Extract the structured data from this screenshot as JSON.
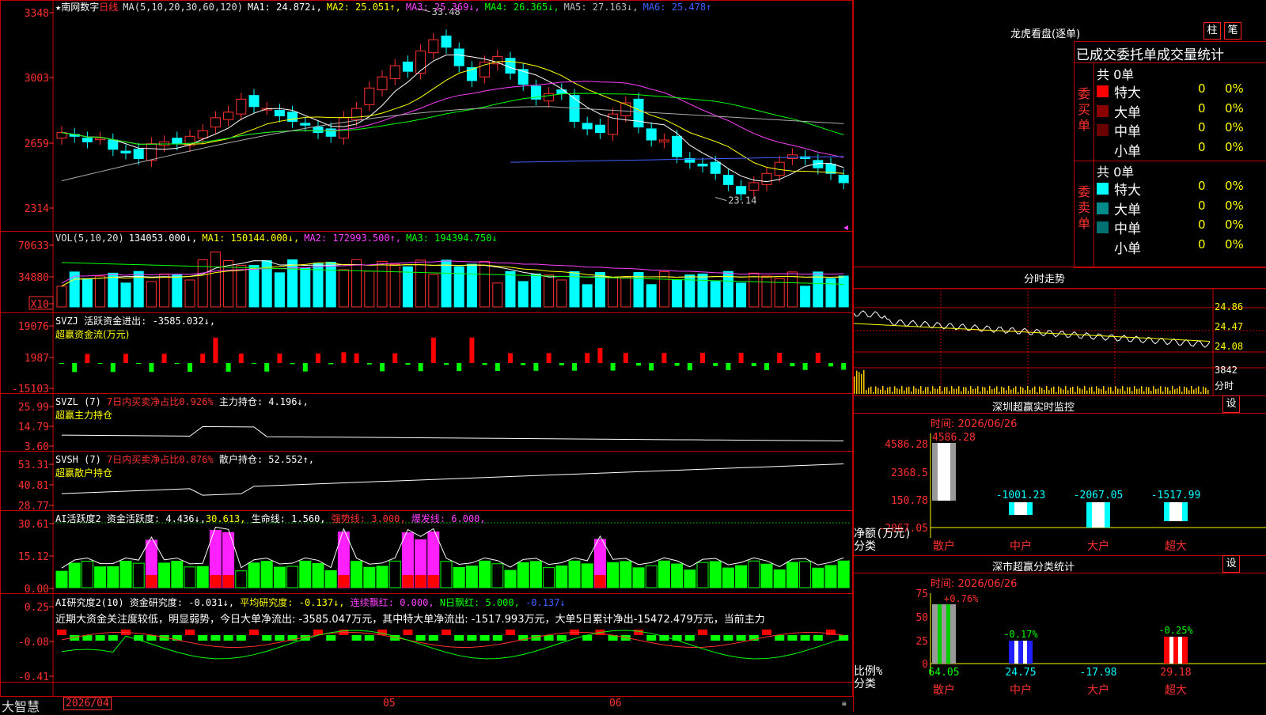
{
  "stock": {
    "star": "★",
    "name": "南网数字",
    "period": "日线"
  },
  "main_axis": [
    "3348",
    "3003",
    "2659",
    "2314"
  ],
  "ma_header": [
    {
      "text": "MA(5,10,20,30,60,120)",
      "color": "#dddddd"
    },
    {
      "text": "MA1: 24.872↓,",
      "color": "#ffffff"
    },
    {
      "text": "MA2: 25.051↑,",
      "color": "#ffff00"
    },
    {
      "text": "MA3: 25.369↓,",
      "color": "#ff40ff"
    },
    {
      "text": "MA4: 26.365↓,",
      "color": "#00ff00"
    },
    {
      "text": "MA5: 27.163↓,",
      "color": "#bbbbbb"
    },
    {
      "text": "MA6: 25.478↑",
      "color": "#4060ff"
    }
  ],
  "high_label": "33.48",
  "low_label": "23.14",
  "vol_axis": [
    "70633",
    "34880",
    "X10"
  ],
  "vol_header": [
    {
      "text": "VOL(5,10,20)",
      "color": "#dddddd"
    },
    {
      "text": "134053.000↓,",
      "color": "#ffffff"
    },
    {
      "text": "MA1: 150144.000↓,",
      "color": "#ffff00"
    },
    {
      "text": "MA2: 172993.500↑,",
      "color": "#ff40ff"
    },
    {
      "text": "MA3: 194394.750↓",
      "color": "#00ff00"
    }
  ],
  "svzj": {
    "axis": [
      "19076",
      "1987",
      "-15103"
    ],
    "line1": "SVZJ  活跃资金进出: -3585.032↓,",
    "line2": "超赢资金流(万元)"
  },
  "svzl": {
    "axis": [
      "25.99",
      "14.79",
      "3.60"
    ],
    "prefix": "SVZL (7)",
    "red": "7日内买卖净占比0.926%",
    "rest": "主力持仓: 4.196↓,",
    "line2": "超赢主力持仓"
  },
  "svsh": {
    "axis": [
      "53.31",
      "40.81",
      "28.77"
    ],
    "prefix": "SVSH (7)",
    "red": "7日内买卖净占比0.876%",
    "rest": "散户持仓: 52.552↑,",
    "line2": "超赢散户持仓"
  },
  "ai1": {
    "axis": [
      "30.61",
      "15.12",
      "0.00"
    ],
    "a": "AI活跃度2 资金活跃度: 4.436↓,",
    "b": "30.613,",
    "c": "生命线: 1.560,",
    "d": "强势线: 3.000,",
    "e": "爆发线: 6.000,"
  },
  "ai2": {
    "axis": [
      "0.25",
      "-0.08",
      "-0.41"
    ],
    "a": "AI研究度2(10) 资金研究度: -0.031↓,",
    "b": "平均研究度: -0.137↓,",
    "c": "连续飘红: 0.000,",
    "d": "N日飘红: 5.000,",
    "e": "-0.137↓",
    "note": "近期大资金关注度较低，明显弱势，今日大单净流出: -3585.047万元，其中特大单净流出: -1517.993万元，大单5日累计净出-15472.479万元，当前主力"
  },
  "footer": {
    "brand": "大智慧",
    "date": "2026/04",
    "m05": "05",
    "m06": "06"
  },
  "right": {
    "lhb_title": "龙虎看盘(逐单)",
    "btn_zhu": "柱",
    "btn_bi": "笔",
    "stats_title": "已成交委托单成交量统计",
    "buy_label": "委买单",
    "sell_label": "委卖单",
    "buy_total": "共 0单",
    "sell_total": "共 0单",
    "rows": [
      {
        "name": "特大",
        "count": "0",
        "pct": "0%"
      },
      {
        "name": "大单",
        "count": "0",
        "pct": "0%"
      },
      {
        "name": "中单",
        "count": "0",
        "pct": "0%"
      },
      {
        "name": "小单",
        "count": "0",
        "pct": "0%"
      }
    ],
    "buy_colors": [
      "#ff0000",
      "#8b0000",
      "#6a0000",
      ""
    ],
    "sell_colors": [
      "#00ffff",
      "#008b8b",
      "#007070",
      ""
    ],
    "fenshi_title": "分时走势",
    "fenshi_axis": [
      "24.86",
      "24.47",
      "24.08",
      "3842",
      "分时"
    ],
    "monitor_title": "深圳超赢实时监控",
    "monitor_btn": "设",
    "monitor_time": "时间: 2026/06/26",
    "monitor_axis": [
      "4586.28",
      "2368.5",
      "150.78",
      "-2067.05"
    ],
    "monitor_labels": [
      "4586.28",
      "-1001.23",
      "-2067.05",
      "-1517.99"
    ],
    "monitor_ylabel": "净额(万元)",
    "monitor_xlabel": "分类",
    "cats": [
      "散户",
      "中户",
      "大户",
      "超大"
    ],
    "class_title": "深市超赢分类统计",
    "class_btn": "设",
    "class_time": "时间: 2026/06/26",
    "class_axis": [
      "75",
      "50",
      "25",
      "0"
    ],
    "class_top": [
      "+0.76%",
      "-0.17%",
      "",
      "-0.25%"
    ],
    "class_bottom": [
      "64.05",
      "24.75",
      "-17.98",
      "29.18"
    ],
    "class_ylabel": "比例%",
    "class_xlabel": "分类"
  }
}
